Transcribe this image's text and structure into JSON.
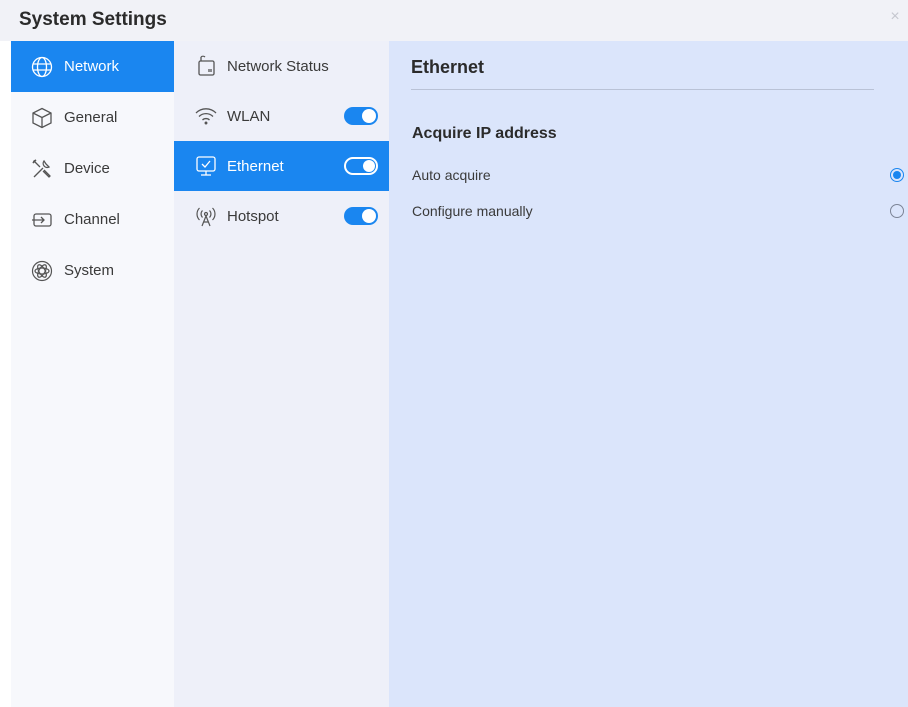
{
  "window": {
    "title": "System Settings",
    "close_glyph": "×"
  },
  "sidebar": {
    "items": [
      {
        "label": "Network",
        "icon": "globe-icon",
        "active": true
      },
      {
        "label": "General",
        "icon": "cube-icon",
        "active": false
      },
      {
        "label": "Device",
        "icon": "tools-icon",
        "active": false
      },
      {
        "label": "Channel",
        "icon": "input-icon",
        "active": false
      },
      {
        "label": "System",
        "icon": "atom-icon",
        "active": false
      }
    ]
  },
  "submenu": {
    "items": [
      {
        "label": "Network Status",
        "icon": "router-icon",
        "toggle": null,
        "active": false
      },
      {
        "label": "WLAN",
        "icon": "wifi-icon",
        "toggle": true,
        "active": false
      },
      {
        "label": "Ethernet",
        "icon": "ethernet-icon",
        "toggle": true,
        "active": true
      },
      {
        "label": "Hotspot",
        "icon": "hotspot-icon",
        "toggle": true,
        "active": false
      }
    ]
  },
  "pane": {
    "title": "Ethernet",
    "section_title": "Acquire IP address",
    "options": [
      {
        "label": "Auto acquire",
        "selected": true
      },
      {
        "label": "Configure manually",
        "selected": false
      }
    ]
  },
  "colors": {
    "accent": "#1a86f0",
    "pane_bg": "#dbe5fb",
    "submenu_bg": "#eef0f9",
    "sidebar_bg": "#f7f8fc"
  }
}
